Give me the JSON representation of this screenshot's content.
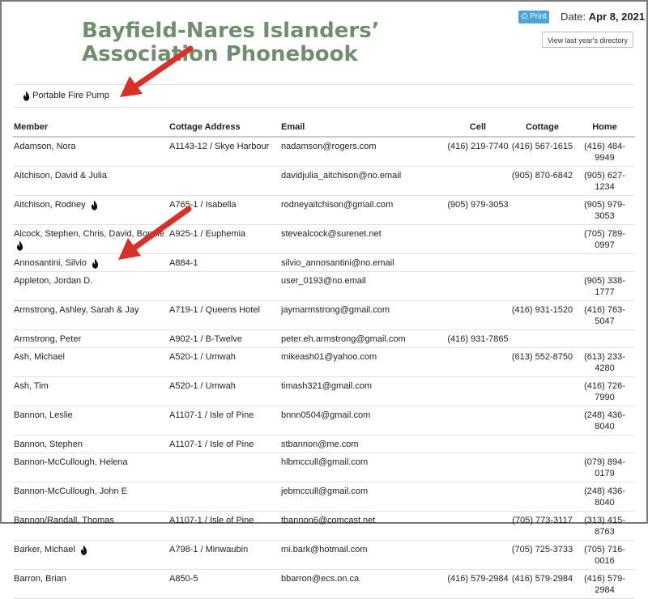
{
  "header": {
    "title": "Bayfield-Nares Islanders’ Association Phonebook",
    "print_label": "Print",
    "date_prefix": "Date:",
    "date_value": "Apr 8, 2021",
    "last_year_label": "View last year's directory"
  },
  "legend": {
    "label": "Portable Fire Pump",
    "icon": "flame-icon"
  },
  "table": {
    "headers": [
      "Member",
      "Cottage Address",
      "Email",
      "Cell",
      "Cottage",
      "Home"
    ],
    "rows": [
      {
        "member": "Adamson, Nora",
        "pump": false,
        "address": "A1143-12 / Skye Harbour",
        "email": "nadamson@rogers.com",
        "cell": "(416) 219-7740",
        "cottage": "(416) 567-1615",
        "home": "(416) 484-9949"
      },
      {
        "member": "Aitchison, David & Julia",
        "pump": false,
        "address": "",
        "email": "davidjulia_aitchison@no.email",
        "cell": "",
        "cottage": "(905) 870-6842",
        "home": "(905) 627-1234"
      },
      {
        "member": "Aitchison, Rodney",
        "pump": true,
        "address": "A765-1 / Isabella",
        "email": "rodneyaitchison@gmail.com",
        "cell": "(905) 979-3053",
        "cottage": "",
        "home": "(905) 979-3053"
      },
      {
        "member": "Alcock, Stephen, Chris, David, Bonnie",
        "pump": true,
        "address": "A925-1 / Euphemia",
        "email": "stevealcock@surenet.net",
        "cell": "",
        "cottage": "",
        "home": "(705) 789-0997"
      },
      {
        "member": "Annosantini, Silvio",
        "pump": true,
        "address": "A884-1",
        "email": "silvio_annosantini@no.email",
        "cell": "",
        "cottage": "",
        "home": ""
      },
      {
        "member": "Appleton, Jordan D.",
        "pump": false,
        "address": "",
        "email": "user_0193@no.email",
        "cell": "",
        "cottage": "",
        "home": "(905) 338-1777"
      },
      {
        "member": "Armstrong, Ashley, Sarah & Jay",
        "pump": false,
        "address": "A719-1 / Queens Hotel",
        "email": "jaymarmstrong@gmail.com",
        "cell": "",
        "cottage": "(416) 931-1520",
        "home": "(416) 763-5047"
      },
      {
        "member": "Armstrong, Peter",
        "pump": false,
        "address": "A902-1 / B-Twelve",
        "email": "peter.eh.armstrong@gmail.com",
        "cell": "(416) 931-7865",
        "cottage": "",
        "home": ""
      },
      {
        "member": "Ash, Michael",
        "pump": false,
        "address": "A520-1 / Umwah",
        "email": "mikeash01@yahoo.com",
        "cell": "",
        "cottage": "(613) 552-8750",
        "home": "(613) 233-4280"
      },
      {
        "member": "Ash, Tim",
        "pump": false,
        "address": "A520-1 / Umwah",
        "email": "timash321@gmail.com",
        "cell": "",
        "cottage": "",
        "home": "(416) 726-7990"
      },
      {
        "member": "Bannon, Leslie",
        "pump": false,
        "address": "A1107-1 / Isle of Pine",
        "email": "bnnn0504@gmail.com",
        "cell": "",
        "cottage": "",
        "home": "(248) 436-8040"
      },
      {
        "member": "Bannon, Stephen",
        "pump": false,
        "address": "A1107-1 / Isle of Pine",
        "email": "stbannon@me.com",
        "cell": "",
        "cottage": "",
        "home": ""
      },
      {
        "member": "Bannon-McCullough, Helena",
        "pump": false,
        "address": "",
        "email": "hlbmccull@gmail.com",
        "cell": "",
        "cottage": "",
        "home": "(079) 894-0179"
      },
      {
        "member": "Bannon-McCullough, John E",
        "pump": false,
        "address": "",
        "email": "jebmccull@gmail.com",
        "cell": "",
        "cottage": "",
        "home": "(248) 436-8040"
      },
      {
        "member": "Bannon/Randall, Thomas",
        "pump": false,
        "address": "A1107-1 / Isle of Pine",
        "email": "tbannon6@comcast.net",
        "cell": "",
        "cottage": "(705) 773-3117",
        "home": "(313) 415-8763"
      },
      {
        "member": "Barker, Michael",
        "pump": true,
        "address": "A798-1 / Minwaubin",
        "email": "mi.bark@hotmail.com",
        "cell": "",
        "cottage": "(705) 725-3733",
        "home": "(705) 716-0016"
      },
      {
        "member": "Barron, Brian",
        "pump": false,
        "address": "A850-5",
        "email": "bbarron@ecs.on.ca",
        "cell": "(416) 579-2984",
        "cottage": "(416) 579-2984",
        "home": "(416) 579-2984"
      }
    ]
  },
  "colors": {
    "title": "#6f8f6f",
    "print_button": "#4fa3d6",
    "arrow": "#d9302a"
  }
}
